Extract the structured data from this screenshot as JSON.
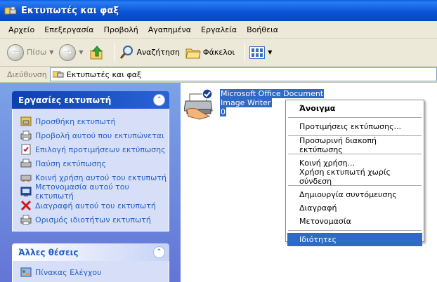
{
  "window": {
    "title": "Εκτυπωτές και φαξ"
  },
  "menubar": {
    "items": [
      "Αρχείο",
      "Επεξεργασία",
      "Προβολή",
      "Αγαπημένα",
      "Εργαλεία",
      "Βοήθεια"
    ]
  },
  "toolbar": {
    "back_label": "Πίσω",
    "search_label": "Αναζήτηση",
    "folders_label": "Φάκελοι"
  },
  "addressbar": {
    "label": "Διεύθυνση",
    "value": "Εκτυπωτές και φαξ"
  },
  "tasks_panel": {
    "title": "Εργασίες εκτυπωτή",
    "items": [
      {
        "label": "Προσθήκη εκτυπωτή",
        "icon": "add-printer-icon"
      },
      {
        "label": "Προβολή αυτού που εκτυπώνεται",
        "icon": "view-queue-icon"
      },
      {
        "label": "Επιλογή προτιμήσεων εκτύπωσης",
        "icon": "preferences-icon"
      },
      {
        "label": "Παύση εκτύπωσης",
        "icon": "pause-printer-icon"
      },
      {
        "label": "Κοινή χρήση αυτού του εκτυπωτή",
        "icon": "share-printer-icon"
      },
      {
        "label": "Μετονομασία αυτού του εκτυπωτή",
        "icon": "rename-icon"
      },
      {
        "label": "Διαγραφή αυτού του εκτυπωτή",
        "icon": "delete-icon"
      },
      {
        "label": "Ορισμός ιδιοτήτων εκτυπωτή",
        "icon": "properties-icon"
      }
    ]
  },
  "places_panel": {
    "title": "Άλλες θέσεις",
    "items": [
      {
        "label": "Πίνακας Ελέγχου",
        "icon": "control-panel-icon"
      }
    ]
  },
  "printer": {
    "name_line1": "Microsoft Office Document",
    "name_line2": "Image Writer",
    "jobs": "0"
  },
  "context_menu": {
    "open": "Άνοιγμα",
    "print_prefs": "Προτιμήσεις εκτύπωσης...",
    "pause": "Προσωρινή διακοπή εκτύπωσης",
    "sharing": "Κοινή χρήση...",
    "offline": "Χρήση εκτυπωτή χωρίς σύνδεση",
    "create_shortcut": "Δημιουργία συντόμευσης",
    "delete": "Διαγραφή",
    "rename": "Μετονομασία",
    "properties": "Ιδιότητες"
  },
  "colors": {
    "titlebar": "#0a55d8",
    "selection": "#316ac5",
    "task_link": "#215dc6"
  }
}
